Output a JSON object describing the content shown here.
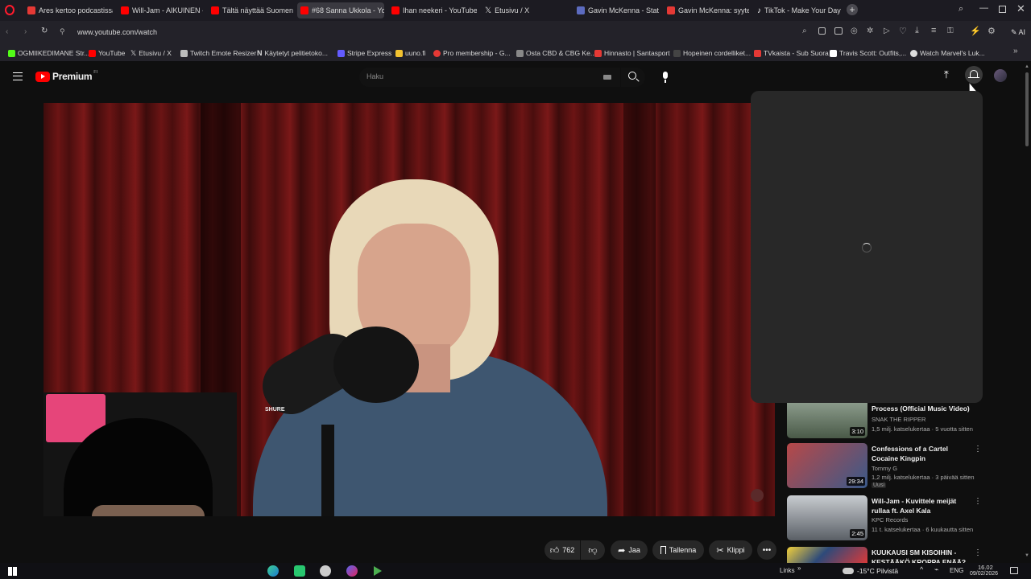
{
  "browser": {
    "tabs": [
      {
        "label": "Ares kertoo podcastissa v...",
        "color": "#e53935"
      },
      {
        "label": "Will-Jam - AIKUINEN - Yo",
        "color": "#ff0000"
      },
      {
        "label": "Tältä näyttää Suomen suu",
        "color": "#ff0000"
      },
      {
        "label": "#68 Sanna Ukkola - YouTu",
        "color": "#ff0000"
      },
      {
        "label": "Ihan neekeri - YouTube",
        "color": "#ff0000"
      },
      {
        "label": "Etusivu / X",
        "color": "#ffffff"
      },
      {
        "label": "Gavin McKenna - Stats, C",
        "color": "#5c6bc0"
      },
      {
        "label": "Gavin McKenna: syytetää",
        "color": "#e53935"
      },
      {
        "label": "TikTok - Make Your Day",
        "color": "#25f4ee"
      }
    ],
    "url": "www.youtube.com/watch",
    "bookmarks": [
      {
        "label": "OGMIIKEDIMANE Str...",
        "color": "#53fc18"
      },
      {
        "label": "YouTube",
        "color": "#ff0000"
      },
      {
        "label": "Etusivu / X",
        "color": "#ffffff"
      },
      {
        "label": "Twitch Emote Resizer",
        "color": "#bbbbbb"
      },
      {
        "label": "Käytetyt pelitietoko...",
        "color": "#ffffff"
      },
      {
        "label": "Stripe Express",
        "color": "#635bff"
      },
      {
        "label": "uuno.fi",
        "color": "#f2c230"
      },
      {
        "label": "Pro membership - G...",
        "color": "#e53935"
      },
      {
        "label": "Osta CBD & CBG Ke...",
        "color": "#888888"
      },
      {
        "label": "Hinnasto | Santasport",
        "color": "#e53935"
      },
      {
        "label": "Hopeinen cordelliket...",
        "color": "#444444"
      },
      {
        "label": "TVkaista - Sub Suora",
        "color": "#e53935"
      },
      {
        "label": "Travis Scott: Outfits,...",
        "color": "#ffffff"
      },
      {
        "label": "Watch Marvel's Luk...",
        "color": "#dddddd"
      }
    ],
    "ai_label": "AI"
  },
  "youtube": {
    "logo_text": "Premium",
    "logo_badge": "FI",
    "search_placeholder": "Haku",
    "actions": {
      "likes": "762",
      "share": "Jaa",
      "save": "Tallenna",
      "clip": "Klippi"
    },
    "recommendations": [
      {
        "title": "Process (Official Music Video)",
        "channel": "SNAK THE RIPPER",
        "meta": "1,5 milj. katselukertaa · 5 vuotta sitten",
        "duration": "3:10",
        "thumb_color": "#5a6b55"
      },
      {
        "title": "Confessions of a Cartel Cocaine Kingpin",
        "channel": "Tommy G",
        "meta": "1,2 milj. katselukertaa · 3 päivää sitten",
        "badge": "Uusi",
        "duration": "29:34",
        "thumb_color": "#7a4040"
      },
      {
        "title": "Will-Jam - Kuvittele meijät rullaa ft. Axel Kala",
        "channel": "KPC Records",
        "meta": "11 t. katselukertaa · 6 kuukautta sitten",
        "duration": "2:45",
        "thumb_color": "#6b6f75"
      },
      {
        "title": "KUUKAUSI SM KISOIHIN - KESTÄÄKÖ KROPPA ENÄÄ?",
        "channel": "",
        "meta": "",
        "duration": "",
        "thumb_color": "#2d4a7a"
      }
    ]
  },
  "taskbar": {
    "links": "Links",
    "weather": "-15°C  Pilvistä",
    "lang": "ENG",
    "time": "16.02",
    "date": "09/02/2026"
  }
}
